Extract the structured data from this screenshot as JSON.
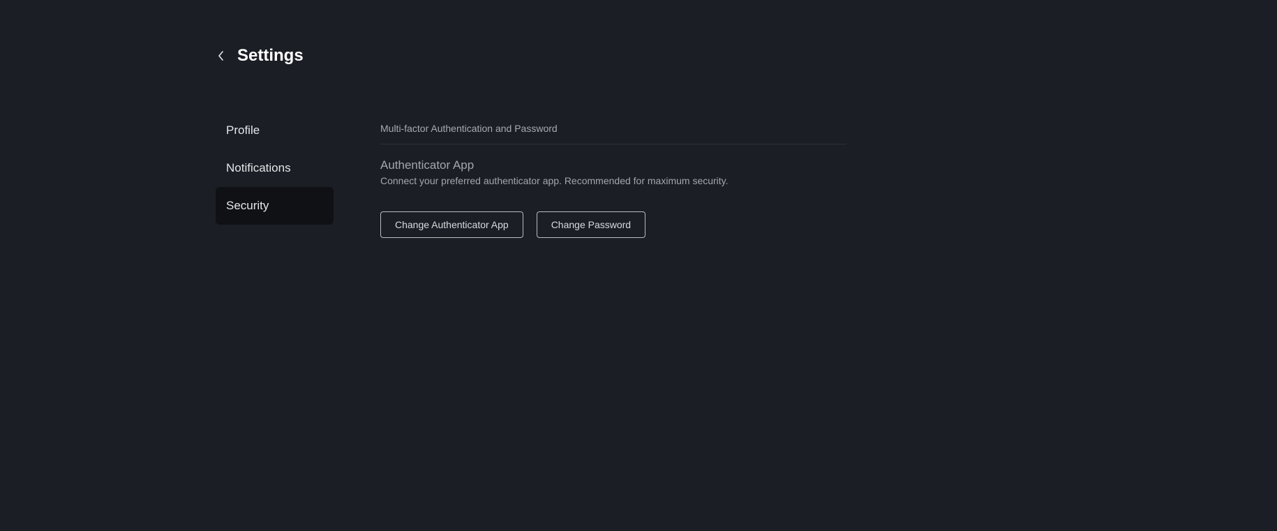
{
  "header": {
    "title": "Settings",
    "back_icon": "chevron-left-icon"
  },
  "sidebar": {
    "items": [
      {
        "label": "Profile",
        "active": false
      },
      {
        "label": "Notifications",
        "active": false
      },
      {
        "label": "Security",
        "active": true
      }
    ]
  },
  "main": {
    "section_title": "Multi-factor Authentication and Password",
    "authenticator": {
      "title": "Authenticator App",
      "description": "Connect your preferred authenticator app. Recommended for maximum security."
    },
    "buttons": {
      "change_authenticator": "Change Authenticator App",
      "change_password": "Change Password"
    }
  },
  "colors": {
    "background": "#1b1e24",
    "active_item": "#0f1115",
    "divider": "#2c3038",
    "button_border": "#b8bcc4"
  }
}
